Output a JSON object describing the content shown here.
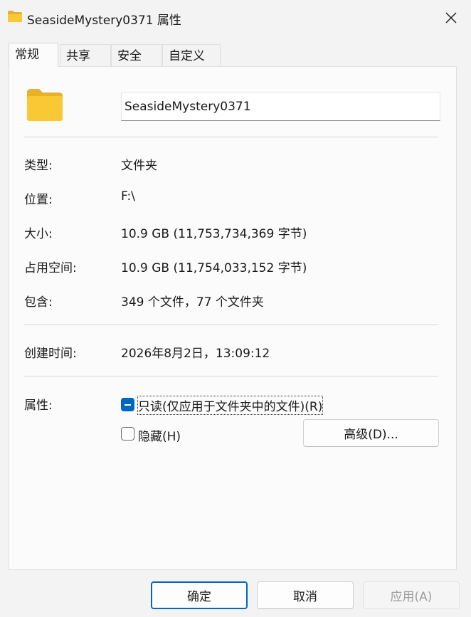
{
  "window": {
    "title": "SeasideMystery0371 属性",
    "close_icon": "close-icon"
  },
  "tabs": [
    {
      "label": "常规",
      "active": true
    },
    {
      "label": "共享",
      "active": false
    },
    {
      "label": "安全",
      "active": false
    },
    {
      "label": "自定义",
      "active": false
    }
  ],
  "general": {
    "folder_icon": "folder-icon",
    "name_value": "SeasideMystery0371",
    "rows": [
      {
        "label": "类型:",
        "value": "文件夹"
      },
      {
        "label": "位置:",
        "value": "F:\\"
      },
      {
        "label": "大小:",
        "value": "10.9 GB (11,753,734,369 字节)"
      },
      {
        "label": "占用空间:",
        "value": "10.9 GB (11,754,033,152 字节)"
      },
      {
        "label": "包含:",
        "value": "349 个文件，77 个文件夹"
      }
    ],
    "created_label": "创建时间:",
    "created_value": "2026年8月2日，13:09:12",
    "attributes_label": "属性:",
    "readonly_label": "只读(仅应用于文件夹中的文件)(R)",
    "readonly_state": "indeterminate",
    "hidden_label": "隐藏(H)",
    "hidden_state": "unchecked",
    "advanced_label": "高级(D)..."
  },
  "footer": {
    "ok_label": "确定",
    "cancel_label": "取消",
    "apply_label": "应用(A)"
  },
  "colors": {
    "accent": "#0067c0",
    "folder_yellow": "#f8c935"
  }
}
